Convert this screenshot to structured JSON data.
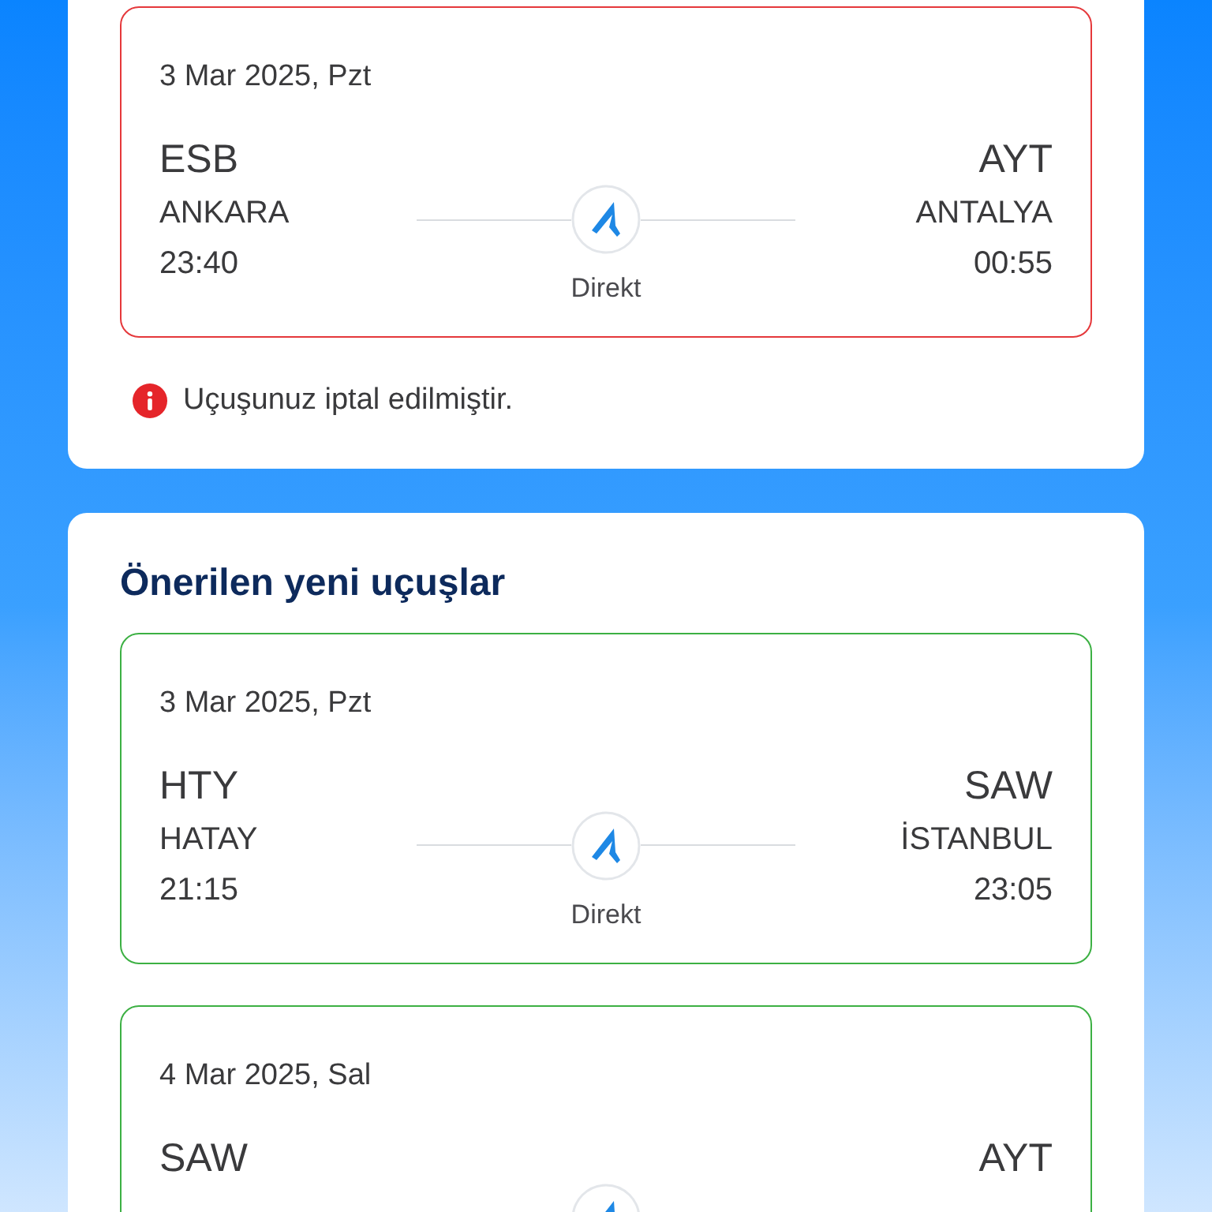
{
  "cancelled_booking": {
    "flight": {
      "cancelled": true,
      "date": "3 Mar 2025, Pzt",
      "from_code": "ESB",
      "from_city": "ANKARA",
      "departure": "23:40",
      "to_code": "AYT",
      "to_city": "ANTALYA",
      "arrival": "00:55",
      "connection": "Direkt"
    },
    "message": "Uçuşunuz iptal edilmiştir."
  },
  "suggestions": {
    "title": "Önerilen yeni uçuşlar",
    "flights": [
      {
        "cancelled": false,
        "date": "3 Mar 2025, Pzt",
        "from_code": "HTY",
        "from_city": "HATAY",
        "departure": "21:15",
        "to_code": "SAW",
        "to_city": "İSTANBUL",
        "arrival": "23:05",
        "connection": "Direkt"
      },
      {
        "cancelled": false,
        "date": "4 Mar 2025, Sal",
        "from_code": "SAW",
        "to_code": "AYT"
      }
    ]
  }
}
